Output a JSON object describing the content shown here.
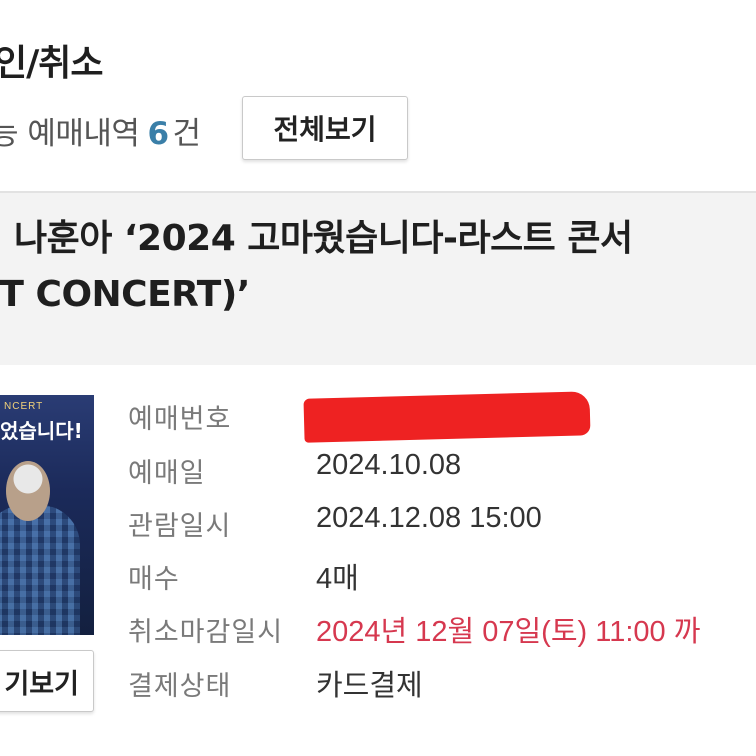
{
  "header": {
    "title": "인/취소",
    "summary_prefix": "능 예매내역",
    "summary_count": "6",
    "summary_suffix": "건",
    "view_all_label": "전체보기"
  },
  "concert": {
    "title_line1": "] 나훈아 ‘2024 고마웠습니다-라스트 콘서",
    "title_line2": "ST CONCERT)’",
    "poster": {
      "concert_text": "NCERT",
      "title_text": "었습니다!"
    },
    "poster_button_label": "기보기",
    "details": [
      {
        "label": "예매번호",
        "value": ""
      },
      {
        "label": "예매일",
        "value": "2024.10.08"
      },
      {
        "label": "관람일시",
        "value": "2024.12.08 15:00"
      },
      {
        "label": "매수",
        "value": "4매"
      },
      {
        "label": "취소마감일시",
        "value": "2024년 12월 07일(토) 11:00 까"
      },
      {
        "label": "결제상태",
        "value": "카드결제"
      }
    ],
    "deadline_color": "#d6384f",
    "redaction_color": "#ee2222"
  }
}
